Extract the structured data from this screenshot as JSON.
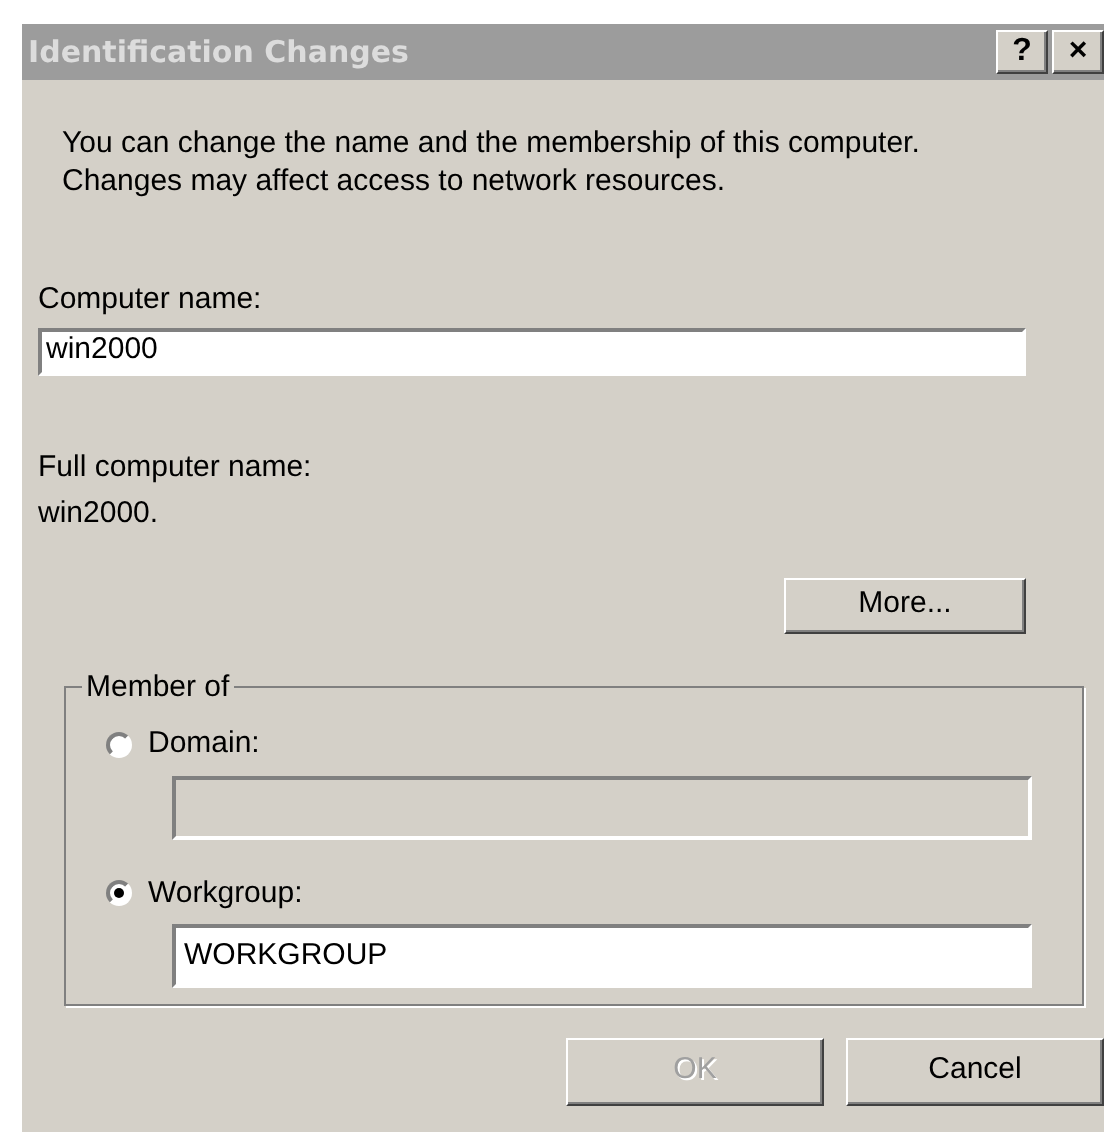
{
  "window": {
    "title": "Identification Changes",
    "title_buttons": [
      "?",
      "×"
    ]
  },
  "description": "You can change the name and the membership of this computer. Changes may affect access to network resources.",
  "computer_name": {
    "label": "Computer name:",
    "value": "win2000"
  },
  "full_name": {
    "label": "Full computer name:",
    "value": "win2000."
  },
  "more_button": "More...",
  "member_of": {
    "title": "Member of",
    "options": [
      {
        "label": "Domain:",
        "selected": false,
        "field": {
          "disabled": true
        }
      },
      {
        "label": "Workgroup:",
        "selected": true,
        "field": {
          "value": "WORKGROUP",
          "disabled": false
        }
      }
    ]
  },
  "buttons": [
    {
      "label": "OK",
      "disabled": true
    },
    {
      "label": "Cancel",
      "disabled": false
    }
  ]
}
